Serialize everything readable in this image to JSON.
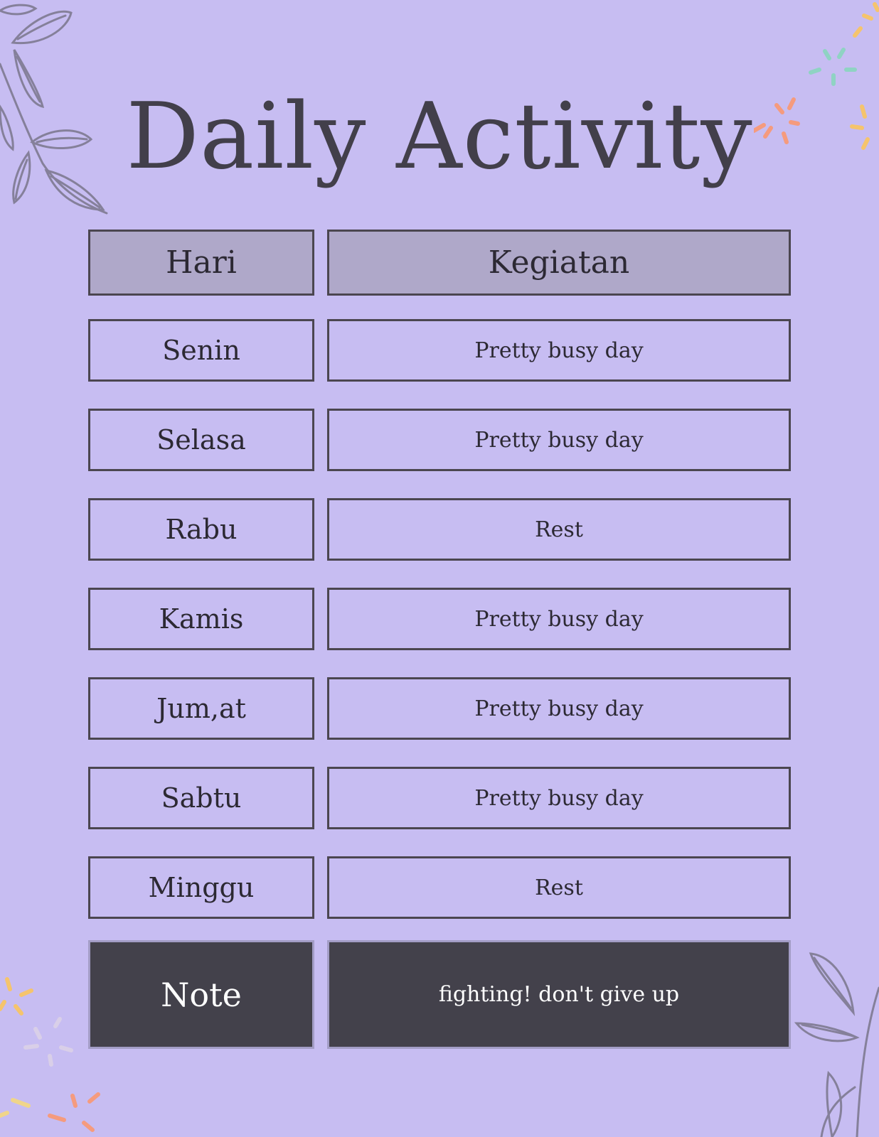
{
  "title": "Daily Activity",
  "table": {
    "headers": {
      "day": "Hari",
      "activity": "Kegiatan"
    },
    "rows": [
      {
        "day": "Senin",
        "activity": "Pretty busy day"
      },
      {
        "day": "Selasa",
        "activity": "Pretty busy day"
      },
      {
        "day": "Rabu",
        "activity": "Rest"
      },
      {
        "day": "Kamis",
        "activity": "Pretty busy day"
      },
      {
        "day": "Jum,at",
        "activity": "Pretty busy day"
      },
      {
        "day": "Sabtu",
        "activity": "Pretty busy day"
      },
      {
        "day": "Minggu",
        "activity": "Rest"
      }
    ],
    "note": {
      "label": "Note",
      "text": "fighting! don't give up"
    }
  },
  "colors": {
    "background": "#c7bdf2",
    "header_fill": "#afa8c9",
    "note_fill": "#43414b",
    "border": "#4b4650"
  },
  "decorations": [
    "leaf-branch-icon",
    "sparkle-burst-icon"
  ]
}
